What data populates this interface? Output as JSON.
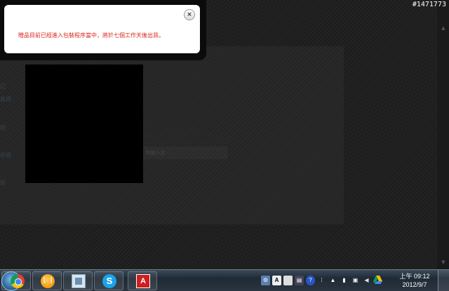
{
  "image_id": "#1471773",
  "popup": {
    "message": "贈品目前已經進入包裝程序當中，將於七個工作天後出貨。",
    "close_glyph": "×"
  },
  "background_page": {
    "side_labels": [
      "記",
      "員資",
      "相",
      "密碼",
      "號"
    ],
    "input_placeholder": "對輸入此"
  },
  "taskbar": {
    "pinned_apps": [
      "chrome-icon",
      "orange-app-icon",
      "explorer-icon",
      "skype-icon",
      "adobe-acrobat-icon"
    ],
    "skype_glyph": "S",
    "adobe_glyph": "A",
    "tray": {
      "ime_label": "A",
      "help_label": "?"
    },
    "clock": {
      "time": "上午 09:12",
      "date": "2012/9/7"
    }
  }
}
